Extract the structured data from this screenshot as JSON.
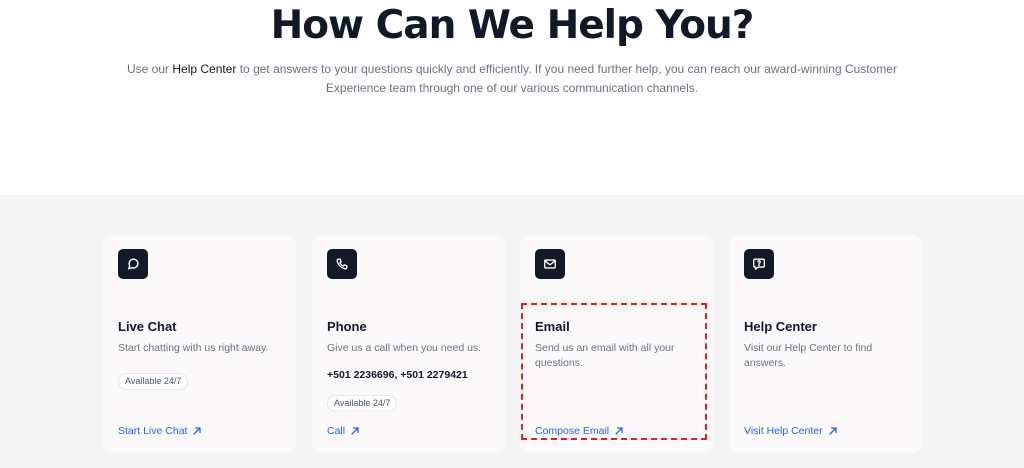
{
  "hero": {
    "title": "How Can We Help You?",
    "intro_before": "Use our ",
    "intro_link": "Help Center",
    "intro_after": " to get answers to your questions quickly and efficiently. If you need further help, you can reach our award-winning Customer Experience team through one of our various communication channels."
  },
  "cards": {
    "live_chat": {
      "icon": "chat-bubble-icon",
      "title": "Live Chat",
      "description": "Start chatting with us right away.",
      "badge": "Available 24/7",
      "link": "Start Live Chat"
    },
    "phone": {
      "icon": "phone-icon",
      "title": "Phone",
      "description": "Give us a call when you need us.",
      "numbers": "+501 2236696, +501 2279421",
      "badge": "Available 24/7",
      "link": "Call"
    },
    "email": {
      "icon": "envelope-icon",
      "title": "Email",
      "description": "Send us an email with all your questions.",
      "link": "Compose Email"
    },
    "help_center": {
      "icon": "help-message-icon",
      "title": "Help Center",
      "description": "Visit our Help Center to find answers.",
      "link": "Visit Help Center"
    }
  },
  "colors": {
    "link": "#2563eb",
    "icon_bg": "#111827",
    "highlight": "#e02020",
    "band_bg": "#f4f4f5"
  }
}
